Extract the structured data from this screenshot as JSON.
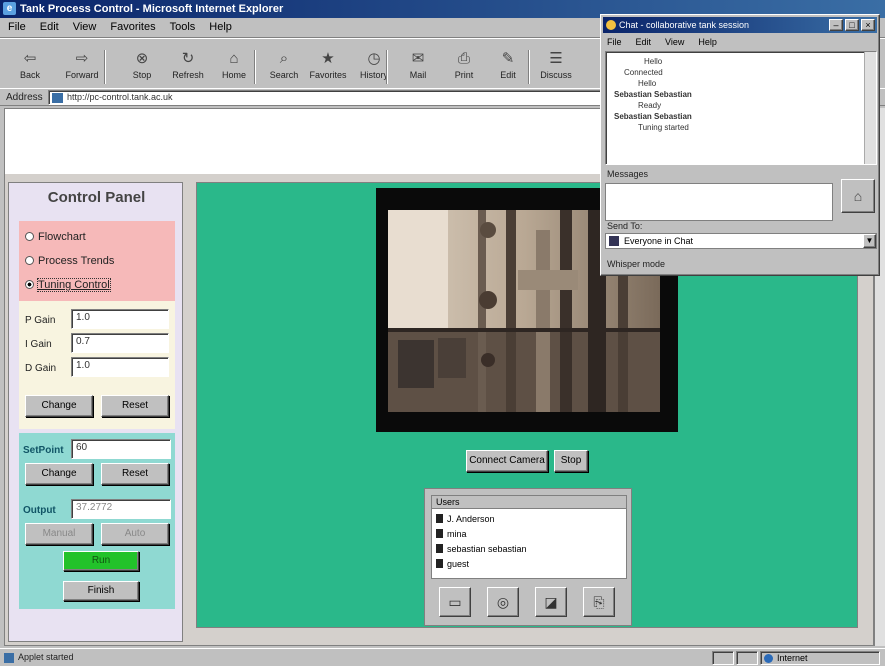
{
  "browser": {
    "title": "Tank Process Control - Microsoft Internet Explorer",
    "menu": [
      "File",
      "Edit",
      "View",
      "Favorites",
      "Tools",
      "Help"
    ],
    "toolbar": [
      {
        "label": "Back",
        "icon": "back-arrow-icon",
        "glyph": "⇦"
      },
      {
        "label": "Forward",
        "icon": "forward-arrow-icon",
        "glyph": "⇨"
      },
      {
        "label": "Stop",
        "icon": "stop-icon",
        "glyph": "⊗"
      },
      {
        "label": "Refresh",
        "icon": "refresh-icon",
        "glyph": "↻"
      },
      {
        "label": "Home",
        "icon": "home-icon",
        "glyph": "⌂"
      },
      {
        "label": "Search",
        "icon": "search-icon",
        "glyph": "⌕"
      },
      {
        "label": "Favorites",
        "icon": "favorites-icon",
        "glyph": "★"
      },
      {
        "label": "History",
        "icon": "history-icon",
        "glyph": "◷"
      },
      {
        "label": "Mail",
        "icon": "mail-icon",
        "glyph": "✉"
      },
      {
        "label": "Print",
        "icon": "print-icon",
        "glyph": "⎙"
      },
      {
        "label": "Edit",
        "icon": "edit-icon",
        "glyph": "✎"
      },
      {
        "label": "Discuss",
        "icon": "discuss-icon",
        "glyph": "☰"
      }
    ],
    "address_label": "Address",
    "address_value": "http://pc-control.tank.ac.uk",
    "status_text": "Applet started",
    "zone_text": "Internet"
  },
  "control_panel": {
    "title": "Control Panel",
    "radios": [
      {
        "label": "Flowchart",
        "checked": false
      },
      {
        "label": "Process Trends",
        "checked": false
      },
      {
        "label": "Tuning Control",
        "checked": true
      }
    ],
    "params": [
      {
        "label": "P Gain",
        "value": "1.0"
      },
      {
        "label": "I Gain",
        "value": "0.7"
      },
      {
        "label": "D Gain",
        "value": "1.0"
      }
    ],
    "change_label": "Change",
    "reset_label": "Reset",
    "setpoint_label": "SetPoint",
    "setpoint_value": "60",
    "change2_label": "Change",
    "reset2_label": "Reset",
    "output_label": "Output",
    "output_value": "37.2772",
    "manual_label": "Manual",
    "auto_label": "Auto",
    "run_label": "Run",
    "finish_label": "Finish"
  },
  "camera": {
    "connect_label": "Connect Camera",
    "stop_label": "Stop"
  },
  "users_panel": {
    "header": "Users",
    "users": [
      "J. Anderson",
      "mina",
      "sebastian sebastian",
      "guest"
    ],
    "tool_icons": [
      "chat-icon",
      "camera-icon",
      "whiteboard-icon",
      "file-transfer-icon"
    ]
  },
  "chat_window": {
    "title": "Chat - collaborative tank session",
    "menu": [
      "File",
      "Edit",
      "View",
      "Help"
    ],
    "log": [
      "Hello",
      "Connected",
      "Hello",
      "Sebastian Sebastian",
      "Ready",
      "Sebastian Sebastian",
      "Tuning started"
    ],
    "message_label": "Messages",
    "send_to_label": "Send To:",
    "send_to_value": "Everyone in Chat",
    "whisper_label": "Whisper mode"
  },
  "colors": {
    "title_bar": "#0a246a",
    "desktop": "#2ab88a",
    "panel_bg": "#e8e2f2",
    "radio_section": "#f6b9b9",
    "param_section": "#f8f4e0",
    "setpoint_section": "#8fd9d2",
    "auto_button": "#22c22a"
  }
}
